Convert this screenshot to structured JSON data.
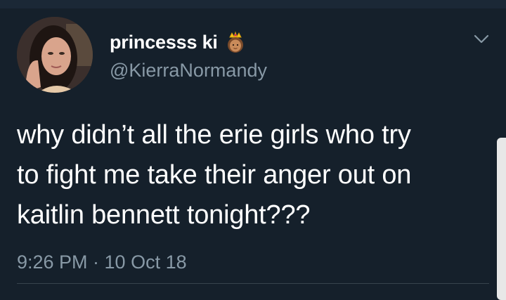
{
  "tweet": {
    "author": {
      "display_name": "princesss ki",
      "name_emoji_icon": "princess-emoji-icon",
      "handle": "@KierraNormandy"
    },
    "text_lines": [
      "why didn’t all the erie girls who try",
      "to fight me take their anger out on",
      "kaitlin bennett tonight???"
    ],
    "timestamp": "9:26 PM · 10 Oct 18",
    "menu_icon": "chevron-down-icon"
  },
  "colors": {
    "background": "#15202b",
    "text_primary": "#ffffff",
    "text_secondary": "#8899a6",
    "divider": "#38444d"
  }
}
